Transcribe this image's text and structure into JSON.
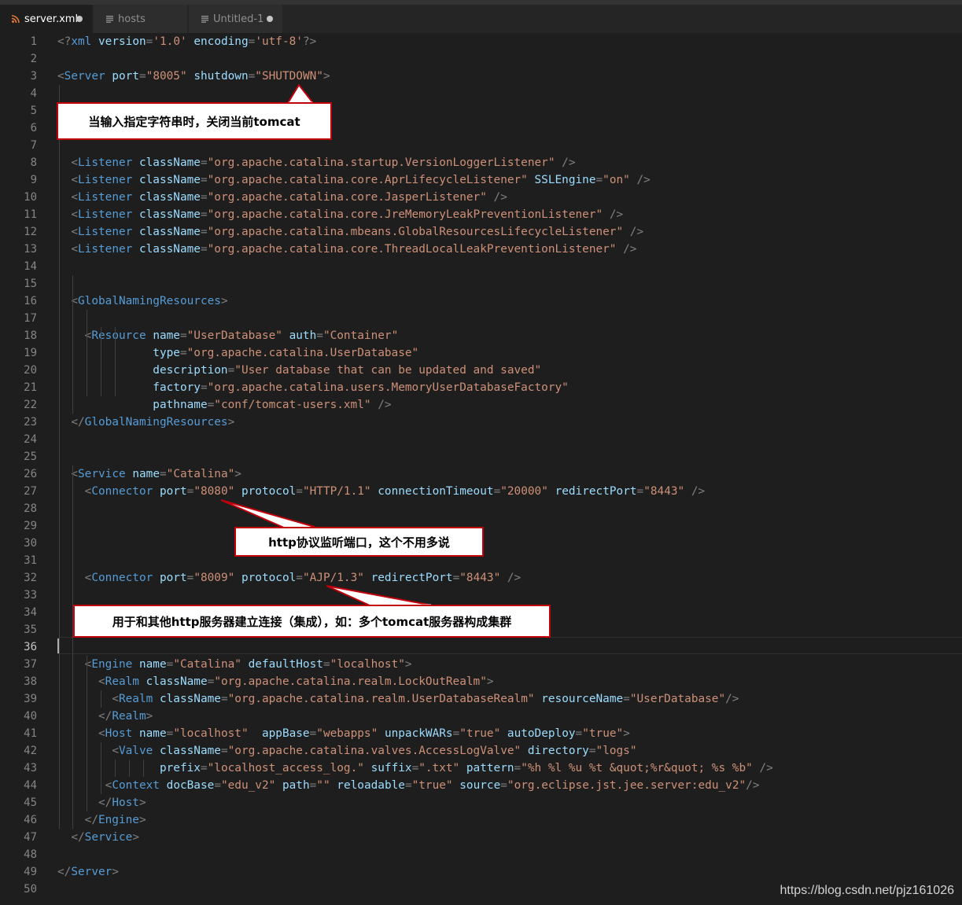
{
  "tabs": [
    {
      "label": "server.xml",
      "icon": "rss-icon",
      "state": "modified",
      "active": true
    },
    {
      "label": "hosts",
      "icon": "lines-icon",
      "state": "normal",
      "active": false
    },
    {
      "label": "Untitled-1",
      "icon": "lines-icon",
      "state": "modified",
      "active": false
    }
  ],
  "editor": {
    "active_line": 36,
    "lines": [
      [
        [
          "p",
          "<?"
        ],
        [
          "t",
          "xml"
        ],
        [
          "t",
          " "
        ],
        [
          "a",
          "version"
        ],
        [
          "p",
          "="
        ],
        [
          "s",
          "'1.0'"
        ],
        [
          "t",
          " "
        ],
        [
          "a",
          "encoding"
        ],
        [
          "p",
          "="
        ],
        [
          "s",
          "'utf-8'"
        ],
        [
          "p",
          "?>"
        ]
      ],
      [],
      [
        [
          "p",
          "<"
        ],
        [
          "t",
          "Server"
        ],
        [
          "t",
          " "
        ],
        [
          "a",
          "port"
        ],
        [
          "p",
          "="
        ],
        [
          "s",
          "\"8005\""
        ],
        [
          "t",
          " "
        ],
        [
          "a",
          "shutdown"
        ],
        [
          "p",
          "="
        ],
        [
          "s",
          "\"SHUTDOWN\""
        ],
        [
          "p",
          ">"
        ]
      ],
      [],
      [],
      [],
      [],
      [
        [
          "w",
          "  "
        ],
        [
          "p",
          "<"
        ],
        [
          "t",
          "Listener"
        ],
        [
          "t",
          " "
        ],
        [
          "a",
          "className"
        ],
        [
          "p",
          "="
        ],
        [
          "s",
          "\"org.apache.catalina.startup.VersionLoggerListener\""
        ],
        [
          "p",
          " />"
        ]
      ],
      [
        [
          "w",
          "  "
        ],
        [
          "p",
          "<"
        ],
        [
          "t",
          "Listener"
        ],
        [
          "t",
          " "
        ],
        [
          "a",
          "className"
        ],
        [
          "p",
          "="
        ],
        [
          "s",
          "\"org.apache.catalina.core.AprLifecycleListener\""
        ],
        [
          "t",
          " "
        ],
        [
          "a",
          "SSLEngine"
        ],
        [
          "p",
          "="
        ],
        [
          "s",
          "\"on\""
        ],
        [
          "p",
          " />"
        ]
      ],
      [
        [
          "w",
          "  "
        ],
        [
          "p",
          "<"
        ],
        [
          "t",
          "Listener"
        ],
        [
          "t",
          " "
        ],
        [
          "a",
          "className"
        ],
        [
          "p",
          "="
        ],
        [
          "s",
          "\"org.apache.catalina.core.JasperListener\""
        ],
        [
          "p",
          " />"
        ]
      ],
      [
        [
          "w",
          "  "
        ],
        [
          "p",
          "<"
        ],
        [
          "t",
          "Listener"
        ],
        [
          "t",
          " "
        ],
        [
          "a",
          "className"
        ],
        [
          "p",
          "="
        ],
        [
          "s",
          "\"org.apache.catalina.core.JreMemoryLeakPreventionListener\""
        ],
        [
          "p",
          " />"
        ]
      ],
      [
        [
          "w",
          "  "
        ],
        [
          "p",
          "<"
        ],
        [
          "t",
          "Listener"
        ],
        [
          "t",
          " "
        ],
        [
          "a",
          "className"
        ],
        [
          "p",
          "="
        ],
        [
          "s",
          "\"org.apache.catalina.mbeans.GlobalResourcesLifecycleListener\""
        ],
        [
          "p",
          " />"
        ]
      ],
      [
        [
          "w",
          "  "
        ],
        [
          "p",
          "<"
        ],
        [
          "t",
          "Listener"
        ],
        [
          "t",
          " "
        ],
        [
          "a",
          "className"
        ],
        [
          "p",
          "="
        ],
        [
          "s",
          "\"org.apache.catalina.core.ThreadLocalLeakPreventionListener\""
        ],
        [
          "p",
          " />"
        ]
      ],
      [],
      [],
      [
        [
          "w",
          "  "
        ],
        [
          "p",
          "<"
        ],
        [
          "t",
          "GlobalNamingResources"
        ],
        [
          "p",
          ">"
        ]
      ],
      [],
      [
        [
          "w",
          "    "
        ],
        [
          "p",
          "<"
        ],
        [
          "t",
          "Resource"
        ],
        [
          "t",
          " "
        ],
        [
          "a",
          "name"
        ],
        [
          "p",
          "="
        ],
        [
          "s",
          "\"UserDatabase\""
        ],
        [
          "t",
          " "
        ],
        [
          "a",
          "auth"
        ],
        [
          "p",
          "="
        ],
        [
          "s",
          "\"Container\""
        ]
      ],
      [
        [
          "w",
          "              "
        ],
        [
          "a",
          "type"
        ],
        [
          "p",
          "="
        ],
        [
          "s",
          "\"org.apache.catalina.UserDatabase\""
        ]
      ],
      [
        [
          "w",
          "              "
        ],
        [
          "a",
          "description"
        ],
        [
          "p",
          "="
        ],
        [
          "s",
          "\"User database that can be updated and saved\""
        ]
      ],
      [
        [
          "w",
          "              "
        ],
        [
          "a",
          "factory"
        ],
        [
          "p",
          "="
        ],
        [
          "s",
          "\"org.apache.catalina.users.MemoryUserDatabaseFactory\""
        ]
      ],
      [
        [
          "w",
          "              "
        ],
        [
          "a",
          "pathname"
        ],
        [
          "p",
          "="
        ],
        [
          "s",
          "\"conf/tomcat-users.xml\""
        ],
        [
          "p",
          " />"
        ]
      ],
      [
        [
          "w",
          "  "
        ],
        [
          "p",
          "</"
        ],
        [
          "t",
          "GlobalNamingResources"
        ],
        [
          "p",
          ">"
        ]
      ],
      [],
      [],
      [
        [
          "w",
          "  "
        ],
        [
          "p",
          "<"
        ],
        [
          "t",
          "Service"
        ],
        [
          "t",
          " "
        ],
        [
          "a",
          "name"
        ],
        [
          "p",
          "="
        ],
        [
          "s",
          "\"Catalina\""
        ],
        [
          "p",
          ">"
        ]
      ],
      [
        [
          "w",
          "    "
        ],
        [
          "p",
          "<"
        ],
        [
          "t",
          "Connector"
        ],
        [
          "t",
          " "
        ],
        [
          "a",
          "port"
        ],
        [
          "p",
          "="
        ],
        [
          "s",
          "\"8080\""
        ],
        [
          "t",
          " "
        ],
        [
          "a",
          "protocol"
        ],
        [
          "p",
          "="
        ],
        [
          "s",
          "\"HTTP/1.1\""
        ],
        [
          "t",
          " "
        ],
        [
          "a",
          "connectionTimeout"
        ],
        [
          "p",
          "="
        ],
        [
          "s",
          "\"20000\""
        ],
        [
          "t",
          " "
        ],
        [
          "a",
          "redirectPort"
        ],
        [
          "p",
          "="
        ],
        [
          "s",
          "\"8443\""
        ],
        [
          "p",
          " />"
        ]
      ],
      [],
      [],
      [],
      [],
      [
        [
          "w",
          "    "
        ],
        [
          "p",
          "<"
        ],
        [
          "t",
          "Connector"
        ],
        [
          "t",
          " "
        ],
        [
          "a",
          "port"
        ],
        [
          "p",
          "="
        ],
        [
          "s",
          "\"8009\""
        ],
        [
          "t",
          " "
        ],
        [
          "a",
          "protocol"
        ],
        [
          "p",
          "="
        ],
        [
          "s",
          "\"AJP/1.3\""
        ],
        [
          "t",
          " "
        ],
        [
          "a",
          "redirectPort"
        ],
        [
          "p",
          "="
        ],
        [
          "s",
          "\"8443\""
        ],
        [
          "p",
          " />"
        ]
      ],
      [],
      [],
      [],
      [],
      [
        [
          "w",
          "    "
        ],
        [
          "p",
          "<"
        ],
        [
          "t",
          "Engine"
        ],
        [
          "t",
          " "
        ],
        [
          "a",
          "name"
        ],
        [
          "p",
          "="
        ],
        [
          "s",
          "\"Catalina\""
        ],
        [
          "t",
          " "
        ],
        [
          "a",
          "defaultHost"
        ],
        [
          "p",
          "="
        ],
        [
          "s",
          "\"localhost\""
        ],
        [
          "p",
          ">"
        ]
      ],
      [
        [
          "w",
          "      "
        ],
        [
          "p",
          "<"
        ],
        [
          "t",
          "Realm"
        ],
        [
          "t",
          " "
        ],
        [
          "a",
          "className"
        ],
        [
          "p",
          "="
        ],
        [
          "s",
          "\"org.apache.catalina.realm.LockOutRealm\""
        ],
        [
          "p",
          ">"
        ]
      ],
      [
        [
          "w",
          "        "
        ],
        [
          "p",
          "<"
        ],
        [
          "t",
          "Realm"
        ],
        [
          "t",
          " "
        ],
        [
          "a",
          "className"
        ],
        [
          "p",
          "="
        ],
        [
          "s",
          "\"org.apache.catalina.realm.UserDatabaseRealm\""
        ],
        [
          "t",
          " "
        ],
        [
          "a",
          "resourceName"
        ],
        [
          "p",
          "="
        ],
        [
          "s",
          "\"UserDatabase\""
        ],
        [
          "p",
          "/>"
        ]
      ],
      [
        [
          "w",
          "      "
        ],
        [
          "p",
          "</"
        ],
        [
          "t",
          "Realm"
        ],
        [
          "p",
          ">"
        ]
      ],
      [
        [
          "w",
          "      "
        ],
        [
          "p",
          "<"
        ],
        [
          "t",
          "Host"
        ],
        [
          "t",
          " "
        ],
        [
          "a",
          "name"
        ],
        [
          "p",
          "="
        ],
        [
          "s",
          "\"localhost\""
        ],
        [
          "t",
          "  "
        ],
        [
          "a",
          "appBase"
        ],
        [
          "p",
          "="
        ],
        [
          "s",
          "\"webapps\""
        ],
        [
          "t",
          " "
        ],
        [
          "a",
          "unpackWARs"
        ],
        [
          "p",
          "="
        ],
        [
          "s",
          "\"true\""
        ],
        [
          "t",
          " "
        ],
        [
          "a",
          "autoDeploy"
        ],
        [
          "p",
          "="
        ],
        [
          "s",
          "\"true\""
        ],
        [
          "p",
          ">"
        ]
      ],
      [
        [
          "w",
          "        "
        ],
        [
          "p",
          "<"
        ],
        [
          "t",
          "Valve"
        ],
        [
          "t",
          " "
        ],
        [
          "a",
          "className"
        ],
        [
          "p",
          "="
        ],
        [
          "s",
          "\"org.apache.catalina.valves.AccessLogValve\""
        ],
        [
          "t",
          " "
        ],
        [
          "a",
          "directory"
        ],
        [
          "p",
          "="
        ],
        [
          "s",
          "\"logs\""
        ]
      ],
      [
        [
          "w",
          "               "
        ],
        [
          "a",
          "prefix"
        ],
        [
          "p",
          "="
        ],
        [
          "s",
          "\"localhost_access_log.\""
        ],
        [
          "t",
          " "
        ],
        [
          "a",
          "suffix"
        ],
        [
          "p",
          "="
        ],
        [
          "s",
          "\".txt\""
        ],
        [
          "t",
          " "
        ],
        [
          "a",
          "pattern"
        ],
        [
          "p",
          "="
        ],
        [
          "s",
          "\"%h %l %u %t &quot;%r&quot; %s %b\""
        ],
        [
          "p",
          " />"
        ]
      ],
      [
        [
          "w",
          "       "
        ],
        [
          "p",
          "<"
        ],
        [
          "t",
          "Context"
        ],
        [
          "t",
          " "
        ],
        [
          "a",
          "docBase"
        ],
        [
          "p",
          "="
        ],
        [
          "s",
          "\"edu_v2\""
        ],
        [
          "t",
          " "
        ],
        [
          "a",
          "path"
        ],
        [
          "p",
          "="
        ],
        [
          "s",
          "\"\""
        ],
        [
          "t",
          " "
        ],
        [
          "a",
          "reloadable"
        ],
        [
          "p",
          "="
        ],
        [
          "s",
          "\"true\""
        ],
        [
          "t",
          " "
        ],
        [
          "a",
          "source"
        ],
        [
          "p",
          "="
        ],
        [
          "s",
          "\"org.eclipse.jst.jee.server:edu_v2\""
        ],
        [
          "p",
          "/>"
        ]
      ],
      [
        [
          "w",
          "      "
        ],
        [
          "p",
          "</"
        ],
        [
          "t",
          "Host"
        ],
        [
          "p",
          ">"
        ]
      ],
      [
        [
          "w",
          "    "
        ],
        [
          "p",
          "</"
        ],
        [
          "t",
          "Engine"
        ],
        [
          "p",
          ">"
        ]
      ],
      [
        [
          "w",
          "  "
        ],
        [
          "p",
          "</"
        ],
        [
          "t",
          "Service"
        ],
        [
          "p",
          ">"
        ]
      ],
      [],
      [
        [
          "p",
          "</"
        ],
        [
          "t",
          "Server"
        ],
        [
          "p",
          ">"
        ]
      ],
      []
    ]
  },
  "annotations": {
    "shutdown_note": "当输入指定字符串时，关闭当前tomcat",
    "http_note": "http协议监听端口，这个不用多说",
    "ajp_note": "用于和其他http服务器建立连接（集成），如：多个tomcat服务器构成集群"
  },
  "watermark": "https://blog.csdn.net/pjz161026",
  "colors": {
    "editor_bg": "#1e1e1e",
    "tag": "#569cd6",
    "attribute": "#9cdcfe",
    "string": "#ce9178",
    "punctuation": "#808080",
    "text": "#d4d4d4",
    "annotation_border": "#c0000b"
  }
}
